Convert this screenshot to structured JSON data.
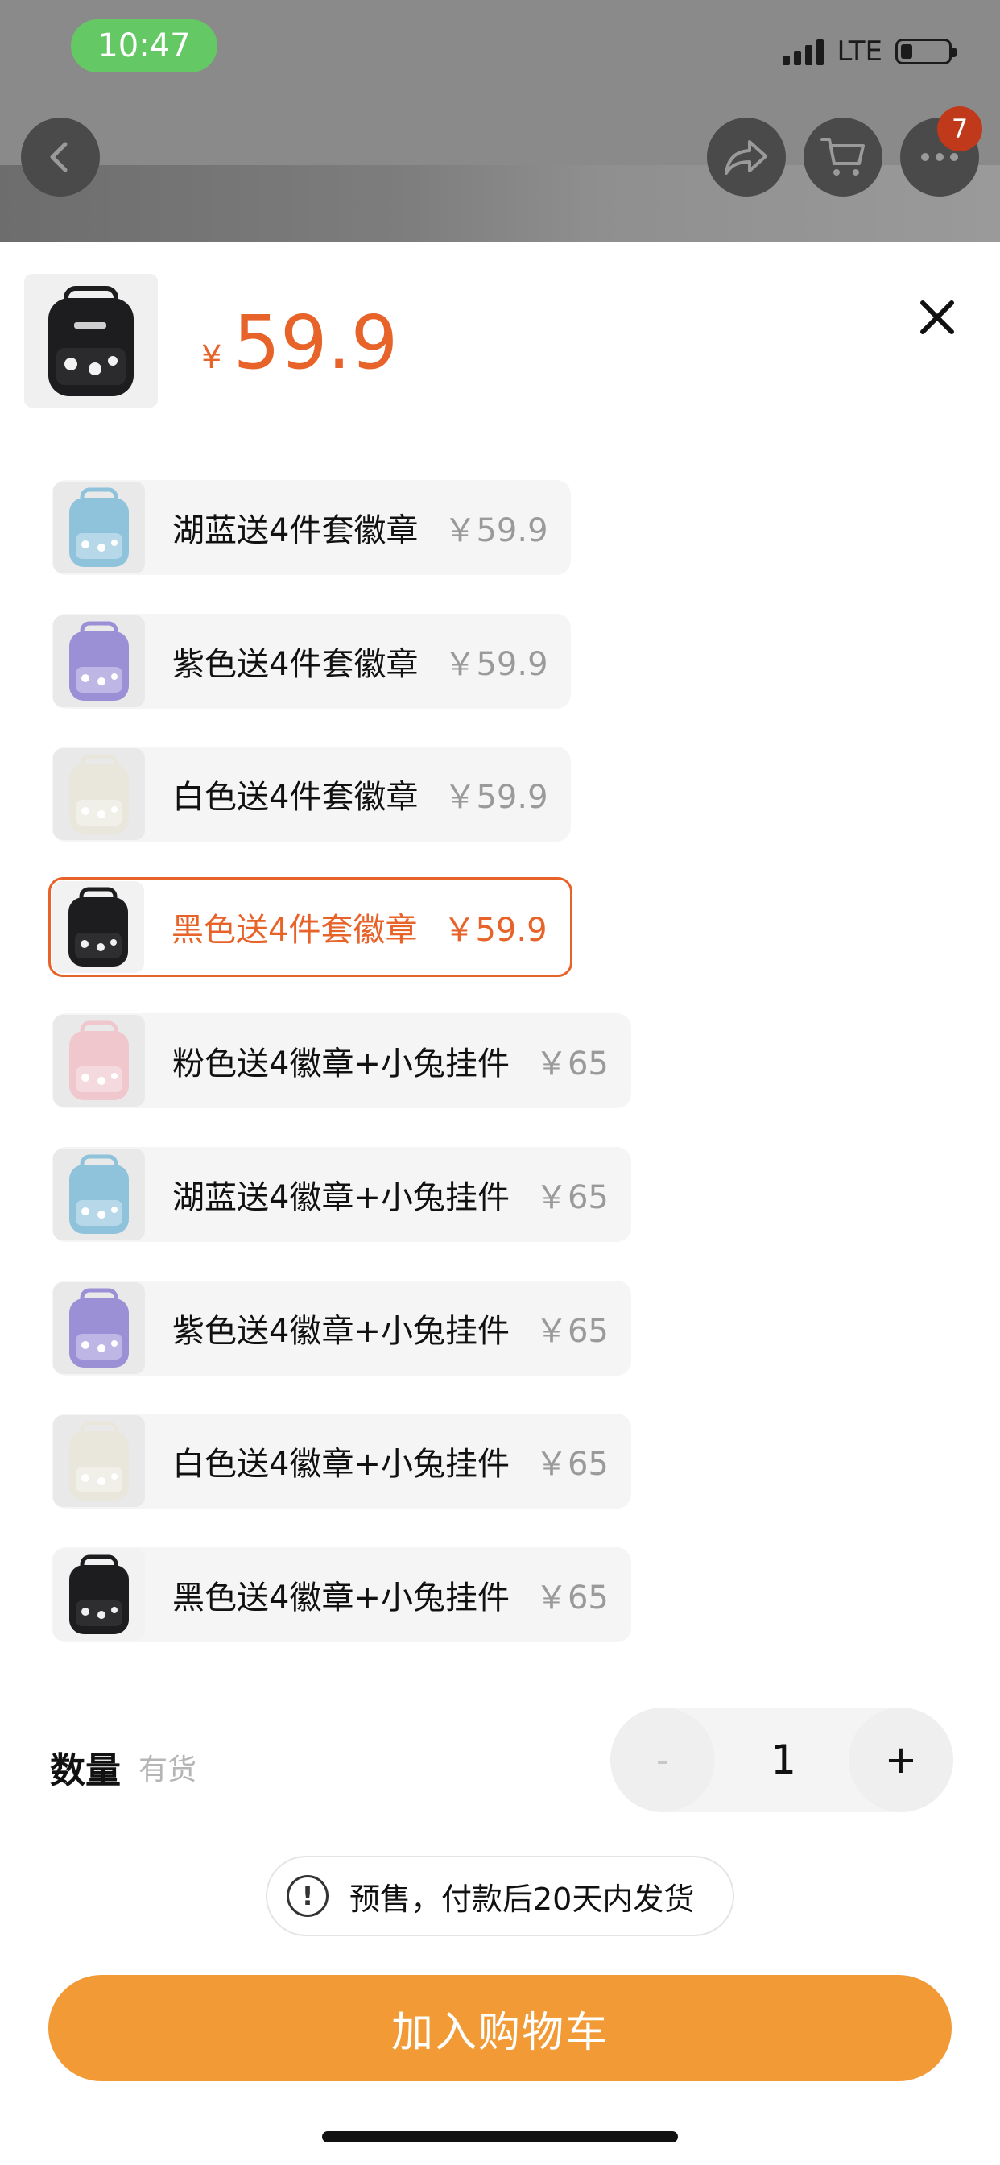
{
  "status_bar": {
    "time": "10:47",
    "network": "LTE"
  },
  "nav": {
    "cart_badge": "7",
    "icons": [
      "back-icon",
      "share-icon",
      "cart-icon",
      "more-icon"
    ]
  },
  "product": {
    "currency": "¥",
    "price": "59.9"
  },
  "options": [
    {
      "label": "湖蓝送4件套徽章",
      "price": "￥59.9",
      "color": "#8fc3dc",
      "selected": false
    },
    {
      "label": "紫色送4件套徽章",
      "price": "￥59.9",
      "color": "#9b8fd6",
      "selected": false
    },
    {
      "label": "白色送4件套徽章",
      "price": "￥59.9",
      "color": "#e9e6dc",
      "selected": false
    },
    {
      "label": "黑色送4件套徽章",
      "price": "￥59.9",
      "color": "#1d1d1f",
      "selected": true
    },
    {
      "label": "粉色送4徽章+小兔挂件",
      "price": "￥65",
      "color": "#efc7cd",
      "selected": false
    },
    {
      "label": "湖蓝送4徽章+小兔挂件",
      "price": "￥65",
      "color": "#8fc3dc",
      "selected": false
    },
    {
      "label": "紫色送4徽章+小兔挂件",
      "price": "￥65",
      "color": "#9b8fd6",
      "selected": false
    },
    {
      "label": "白色送4徽章+小兔挂件",
      "price": "￥65",
      "color": "#e9e6dc",
      "selected": false
    },
    {
      "label": "黑色送4徽章+小兔挂件",
      "price": "￥65",
      "color": "#1d1d1f",
      "selected": false
    }
  ],
  "quantity": {
    "label": "数量",
    "stock": "有货",
    "minus": "-",
    "value": "1",
    "plus": "+"
  },
  "notice": {
    "icon": "!",
    "text": "预售，付款后20天内发货"
  },
  "add_to_cart": "加入购物车",
  "colors": {
    "accent": "#e8632a",
    "button": "#f19a36"
  }
}
